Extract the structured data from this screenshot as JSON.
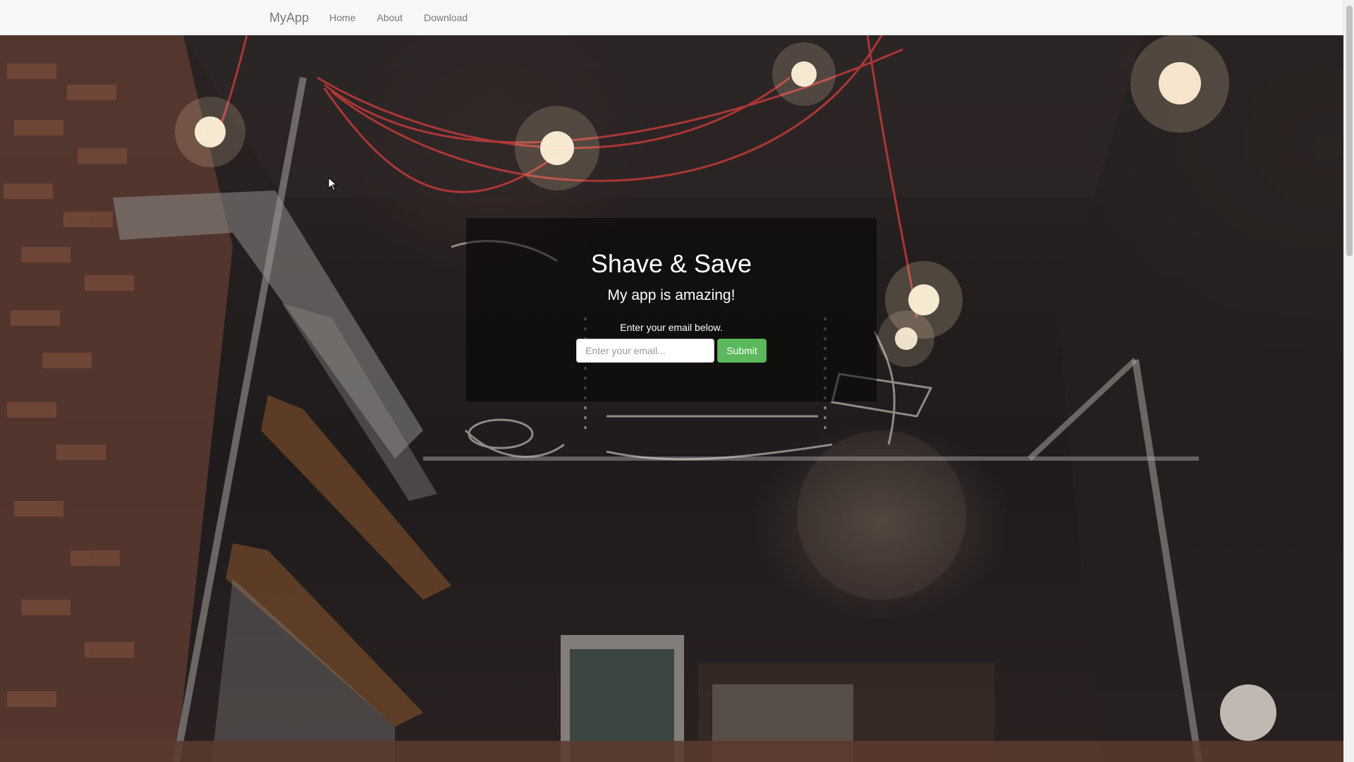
{
  "navbar": {
    "brand": "MyApp",
    "links": [
      {
        "label": "Home"
      },
      {
        "label": "About"
      },
      {
        "label": "Download"
      }
    ]
  },
  "hero": {
    "title": "Shave & Save",
    "subtitle": "My app is amazing!",
    "instruction": "Enter your email below.",
    "email_placeholder": "Enter your email...",
    "email_value": "",
    "submit_label": "Submit"
  },
  "colors": {
    "navbar_bg": "#f8f8f8",
    "nav_text": "#777777",
    "submit_bg": "#5cb85c",
    "hero_text": "#ffffff"
  },
  "icons": {
    "cursor": "mouse-pointer-icon"
  }
}
